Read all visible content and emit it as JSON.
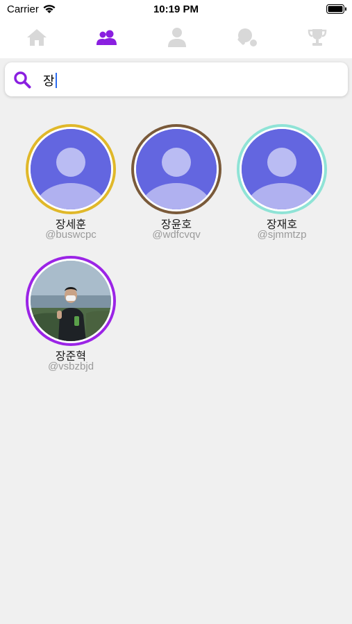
{
  "status_bar": {
    "carrier": "Carrier",
    "time": "10:19 PM"
  },
  "tabs": [
    {
      "name": "home",
      "icon": "home-icon",
      "active": false
    },
    {
      "name": "friends",
      "icon": "users-icon",
      "active": true
    },
    {
      "name": "profile",
      "icon": "user-icon",
      "active": false
    },
    {
      "name": "ping-pong",
      "icon": "ping-pong-icon",
      "active": false
    },
    {
      "name": "trophy",
      "icon": "trophy-icon",
      "active": false
    }
  ],
  "colors": {
    "accent": "#8a1fe0",
    "inactive_icon": "#d8d8d8",
    "avatar_fill": "#6366e0",
    "avatar_silhouette": "#c9cbf6",
    "background": "#f0f0f0"
  },
  "search": {
    "value": "장"
  },
  "users": [
    {
      "name": "장세훈",
      "handle": "@buswcpc",
      "ring_color": "#e0b82a",
      "photo": false
    },
    {
      "name": "장윤호",
      "handle": "@wdfcvqv",
      "ring_color": "#7a5a3a",
      "photo": false
    },
    {
      "name": "장재호",
      "handle": "@sjmmtzp",
      "ring_color": "#8fe3d6",
      "photo": false
    },
    {
      "name": "장준혁",
      "handle": "@vsbzbjd",
      "ring_color": "#9b24e6",
      "photo": true
    }
  ]
}
